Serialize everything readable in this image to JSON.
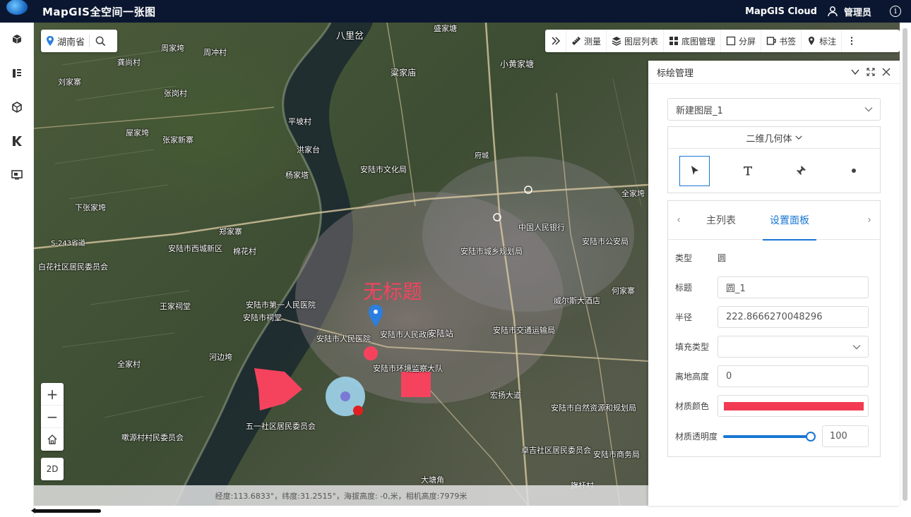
{
  "header": {
    "app_title": "MapGIS全空间一张图",
    "brand": "MapGIS Cloud",
    "user": "管理员"
  },
  "sidebar": {
    "items": [
      {
        "icon": "cube-icon"
      },
      {
        "icon": "list-icon"
      },
      {
        "icon": "box-3d-icon"
      },
      {
        "icon": "k-layer-icon"
      },
      {
        "icon": "monitor-icon"
      }
    ]
  },
  "search": {
    "region": "湖南省"
  },
  "toolbar": {
    "measure": "测量",
    "layer_list": "图层列表",
    "basemap": "底图管理",
    "split": "分屏",
    "bookmark": "书签",
    "annotate": "标注"
  },
  "map": {
    "places": [
      "八里岔",
      "盛家塘",
      "周家垮",
      "周冲村",
      "龚尚村",
      "粱家庙",
      "小黄家塘",
      "刘家寨",
      "张岗村",
      "平坡村",
      "屋家垮",
      "张家新寨",
      "洪家台",
      "安陆市文化局",
      "杨家塔",
      "下张家垮",
      "郑家寨",
      "安陆市西城新区",
      "棉花村",
      "白花社区居民委员会",
      "安陆市人民医院",
      "安陆市第一人民医院",
      "安陆市人民政府",
      "安陆站",
      "安陆市交通运输局",
      "王家祠堂",
      "安陆市祠堂",
      "河边垮",
      "全家村",
      "五一社区居民委员会",
      "嗽源村村民委员会",
      "安陆市自然资源和规划局",
      "卓吉社区居民委员会",
      "安陆市商务局",
      "大塘角",
      "旗杆村",
      "何家寨",
      "威尔斯大酒店",
      "安陆市城乡规划局",
      "中国人民银行",
      "安陆市公安局",
      "全家垮",
      "宏扬大道",
      "安陆市环境监察大队",
      "S-243省道",
      "府城"
    ],
    "annotation_title": "无标题",
    "colors": {
      "shape": "#f5435e",
      "circle_fill": "#9fd4ec",
      "circle_center": "#7a7ad6"
    }
  },
  "zoom": {
    "mode_button": "2D"
  },
  "status": {
    "text": "经度:113.6833°，纬度:31.2515°，海拔高度: -0,米，相机高度:7979米"
  },
  "panel": {
    "title": "标绘管理",
    "layer_select": "新建图层_1",
    "geometry_type": "二维几何体",
    "tools": [
      {
        "icon": "select-arrow-icon",
        "active": true
      },
      {
        "icon": "text-tool-icon",
        "active": false
      },
      {
        "icon": "pin-tool-icon",
        "active": false
      },
      {
        "icon": "point-tool-icon",
        "active": false
      }
    ],
    "tabs": {
      "main_list": "主列表",
      "settings": "设置面板"
    },
    "form": {
      "type_label": "类型",
      "type_value": "圆",
      "title_label": "标题",
      "title_value": "圆_1",
      "radius_label": "半径",
      "radius_value": "222.8666270048296",
      "fill_type_label": "填充类型",
      "fill_type_value": "",
      "height_label": "离地高度",
      "height_value": "0",
      "color_label": "材质颜色",
      "color_value": "#f23b52",
      "opacity_label": "材质透明度",
      "opacity_value": "100",
      "opacity_fraction": 1.0
    }
  }
}
